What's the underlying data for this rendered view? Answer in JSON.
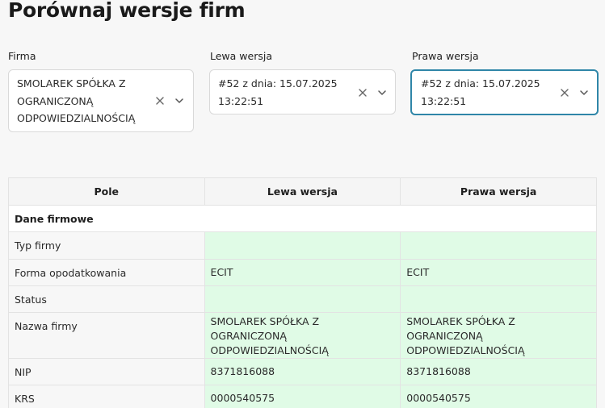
{
  "page": {
    "title": "Porównaj wersje firm"
  },
  "filters": {
    "company": {
      "label": "Firma",
      "value": "SMOLAREK SPÓŁKA Z\nOGRANICZONĄ\nODPOWIEDZIALNOŚCIĄ"
    },
    "left_version": {
      "label": "Lewa wersja",
      "value": "#52 z dnia: 15.07.2025\n13:22:51"
    },
    "right_version": {
      "label": "Prawa wersja",
      "value": "#52 z dnia: 15.07.2025\n13:22:51"
    }
  },
  "icons": {
    "clear": "close-icon",
    "expand": "chevron-down-icon"
  },
  "colors": {
    "match_background": "#e0fbe6",
    "focus_border": "#2f86a8"
  },
  "table": {
    "headers": {
      "field": "Pole",
      "left": "Lewa wersja",
      "right": "Prawa wersja"
    },
    "section": "Dane firmowe",
    "rows": [
      {
        "field": "Typ firmy",
        "left": "",
        "right": ""
      },
      {
        "field": "Forma opodatkowania",
        "left": "ECIT",
        "right": "ECIT"
      },
      {
        "field": "Status",
        "left": "",
        "right": ""
      },
      {
        "field": "Nazwa firmy",
        "left": "SMOLAREK SPÓŁKA Z OGRANICZONĄ ODPOWIEDZIALNOŚCIĄ",
        "right": "SMOLAREK SPÓŁKA Z OGRANICZONĄ ODPOWIEDZIALNOŚCIĄ"
      },
      {
        "field": "NIP",
        "left": "8371816088",
        "right": "8371816088"
      },
      {
        "field": "KRS",
        "left": "0000540575",
        "right": "0000540575"
      }
    ]
  }
}
